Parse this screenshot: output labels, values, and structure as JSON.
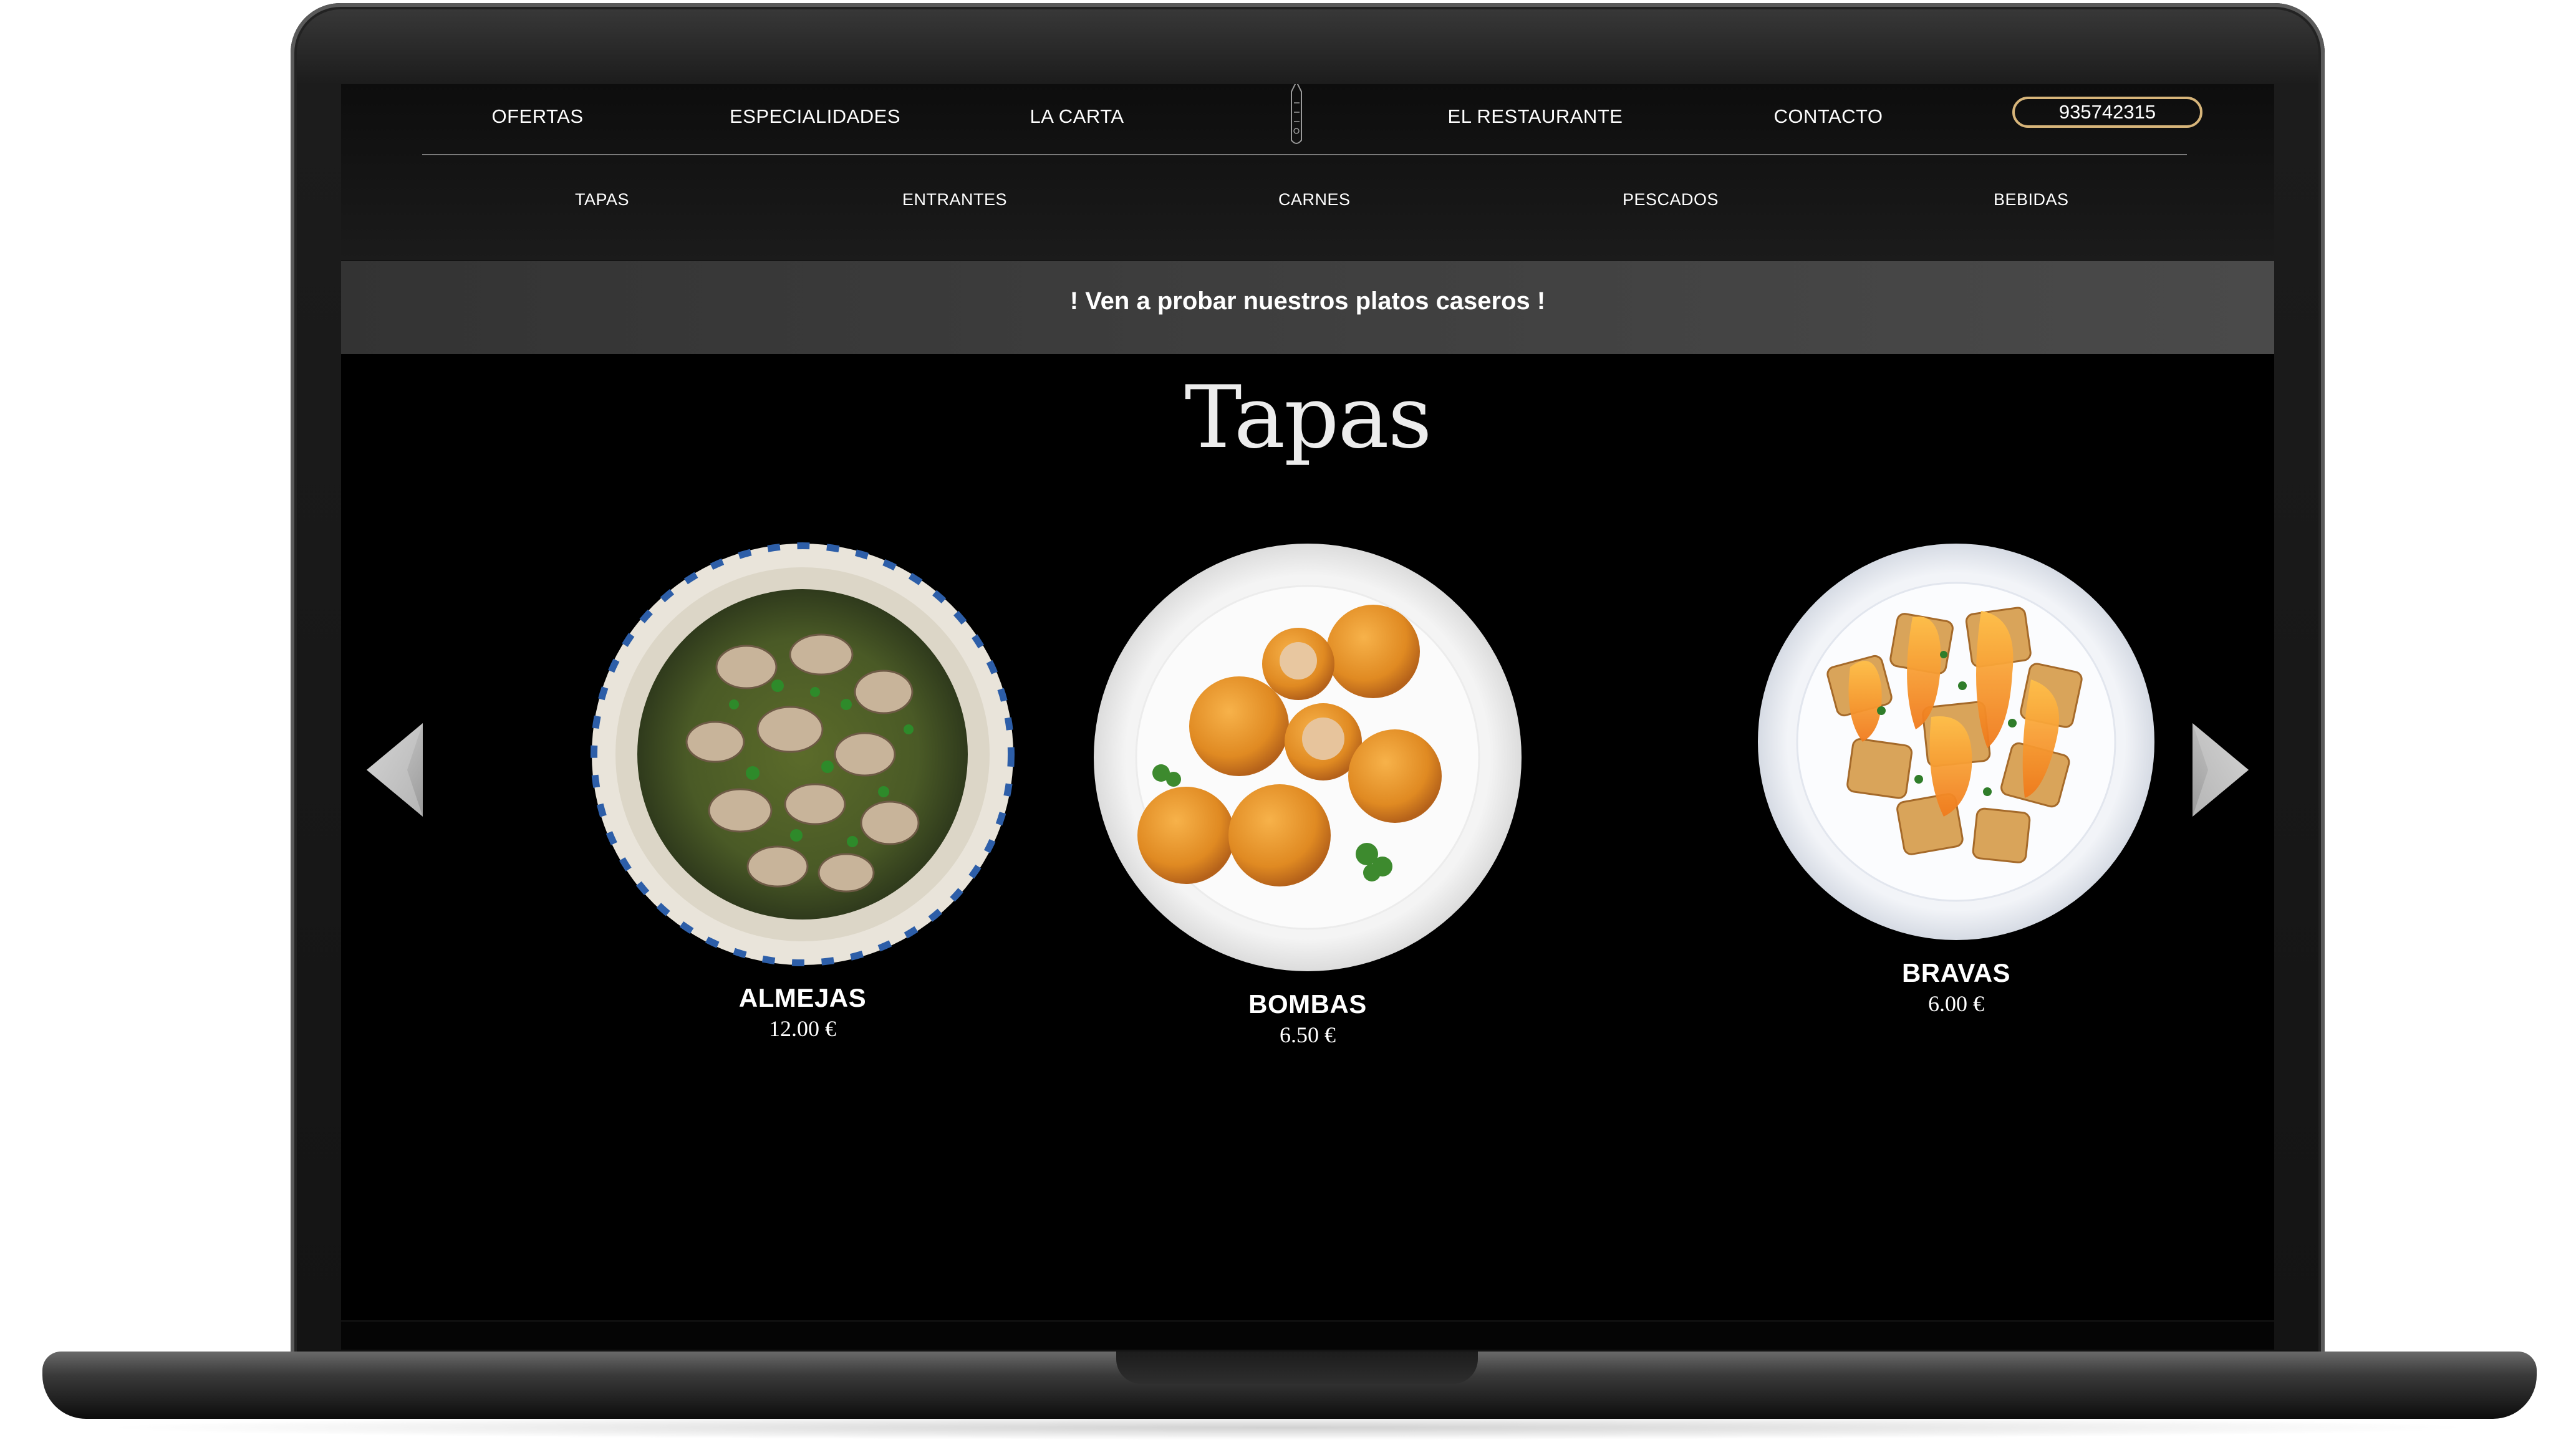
{
  "nav": {
    "items": [
      {
        "id": "ofertas",
        "label": "OFERTAS"
      },
      {
        "id": "especialidades",
        "label": "ESPECIALIDADES"
      },
      {
        "id": "la-carta",
        "label": "LA CARTA"
      },
      {
        "id": "el-restaurante",
        "label": "EL RESTAURANTE"
      },
      {
        "id": "contacto",
        "label": "CONTACTO"
      }
    ],
    "phone": "935742315",
    "accent_color": "#d7b57a"
  },
  "subnav": {
    "items": [
      {
        "label": "TAPAS"
      },
      {
        "label": "ENTRANTES"
      },
      {
        "label": "CARNES"
      },
      {
        "label": "PESCADOS"
      },
      {
        "label": "BEBIDAS"
      }
    ]
  },
  "banner": {
    "text": "! Ven a probar nuestros platos caseros !"
  },
  "section": {
    "title": "Tapas"
  },
  "carousel": {
    "prev_icon": "chevron-left-icon",
    "next_icon": "chevron-right-icon",
    "dishes": [
      {
        "name": "ALMEJAS",
        "price": "12.00 €",
        "image": "clams-plate"
      },
      {
        "name": "BOMBAS",
        "price": "6.50 €",
        "image": "croquette-plate"
      },
      {
        "name": "BRAVAS",
        "price": "6.00 €",
        "image": "patatas-bravas-plate"
      }
    ]
  }
}
